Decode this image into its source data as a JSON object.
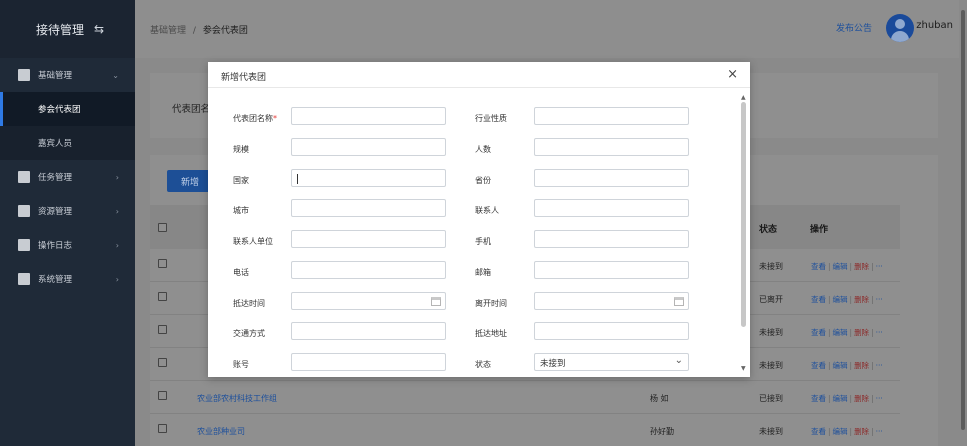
{
  "sidebar": {
    "title": "接待管理",
    "swap_icon": "⇆",
    "items": [
      {
        "label": "基础管理",
        "arrow": "⌄"
      },
      {
        "label": "参会代表团"
      },
      {
        "label": "嘉宾人员"
      },
      {
        "label": "任务管理",
        "arrow": "›"
      },
      {
        "label": "资源管理",
        "arrow": "›"
      },
      {
        "label": "操作日志",
        "arrow": "›"
      },
      {
        "label": "系统管理",
        "arrow": "›"
      }
    ]
  },
  "header": {
    "breadcrumb_parent": "基础管理",
    "breadcrumb_sep": "/",
    "breadcrumb_current": "参会代表团",
    "publish_label": "发布公告",
    "username": "zhuban"
  },
  "search": {
    "label": "代表团名"
  },
  "list": {
    "add_label": "新增",
    "columns": {
      "status": "状态",
      "actions": "操作"
    },
    "action_view": "查看",
    "action_edit": "编辑",
    "action_delete": "删除",
    "action_more": "···",
    "rows": [
      {
        "name": "",
        "contact": "",
        "status": "未接到"
      },
      {
        "name": "",
        "contact": "",
        "status": "已离开"
      },
      {
        "name": "",
        "contact": "",
        "status": "未接到"
      },
      {
        "name": "",
        "contact": "",
        "status": "未接到"
      },
      {
        "name": "农业部农村科技工作组",
        "contact": "杨 如",
        "status": "已接到"
      },
      {
        "name": "农业部种业司",
        "contact": "孙好勤",
        "status": "未接到"
      }
    ]
  },
  "modal": {
    "title": "新增代表团",
    "close": "×",
    "required_mark": "*",
    "fields": {
      "name": "代表团名称",
      "industry": "行业性质",
      "scale": "规模",
      "people": "人数",
      "country": "国家",
      "province": "省份",
      "city": "城市",
      "contact": "联系人",
      "contact_unit": "联系人单位",
      "mobile": "手机",
      "phone": "电话",
      "email": "邮箱",
      "arrive_time": "抵达时间",
      "leave_time": "离开时间",
      "transport": "交通方式",
      "arrive_addr": "抵达地址",
      "account": "账号",
      "status": "状态"
    },
    "status_value": "未接到",
    "scroll_up": "▲",
    "scroll_down": "▼"
  }
}
